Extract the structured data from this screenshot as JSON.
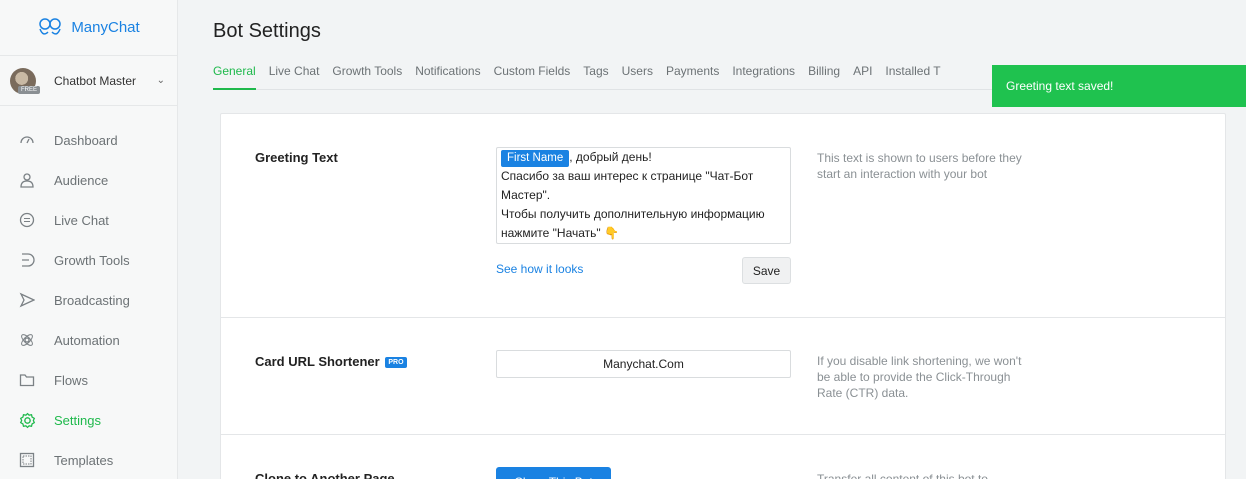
{
  "app": {
    "name": "ManyChat"
  },
  "account": {
    "name": "Chatbot Master",
    "badge": "FREE"
  },
  "sidebar": {
    "items": [
      {
        "label": "Dashboard",
        "icon": "dashboard-icon"
      },
      {
        "label": "Audience",
        "icon": "audience-icon"
      },
      {
        "label": "Live Chat",
        "icon": "live-chat-icon"
      },
      {
        "label": "Growth Tools",
        "icon": "growth-tools-icon"
      },
      {
        "label": "Broadcasting",
        "icon": "broadcasting-icon"
      },
      {
        "label": "Automation",
        "icon": "automation-icon"
      },
      {
        "label": "Flows",
        "icon": "folder-icon"
      },
      {
        "label": "Settings",
        "icon": "settings-icon",
        "active": true
      },
      {
        "label": "Templates",
        "icon": "templates-icon"
      }
    ]
  },
  "header": {
    "title": "Bot Settings"
  },
  "tabs": [
    "General",
    "Live Chat",
    "Growth Tools",
    "Notifications",
    "Custom Fields",
    "Tags",
    "Users",
    "Payments",
    "Integrations",
    "Billing",
    "API",
    "Installed T"
  ],
  "toast": {
    "text": "Greeting text saved!"
  },
  "greeting": {
    "label": "Greeting Text",
    "chip": "First Name",
    "line1_rest": ", добрый день!",
    "line2": "Спасибо за ваш интерес к странице \"Чат-Бот Мастер\".",
    "line3": "Чтобы получить дополнительную информацию нажмите \"Начать\" ",
    "emoji": "👇",
    "description": "This text is shown to users before they start an interaction with your bot",
    "link": "See how it looks",
    "save": "Save"
  },
  "shortener": {
    "label": "Card URL Shortener",
    "badge": "PRO",
    "value": "Manychat.Com",
    "description": "If you disable link shortening, we won't be able to provide the Click-Through Rate (CTR) data."
  },
  "clone": {
    "label": "Clone to Another Page",
    "button": "Clone This Bot",
    "description": "Transfer all content of this bot to"
  },
  "colors": {
    "accent_green": "#1fb94c",
    "brand_blue": "#1a82e2",
    "toast_green": "#1fc24f"
  }
}
